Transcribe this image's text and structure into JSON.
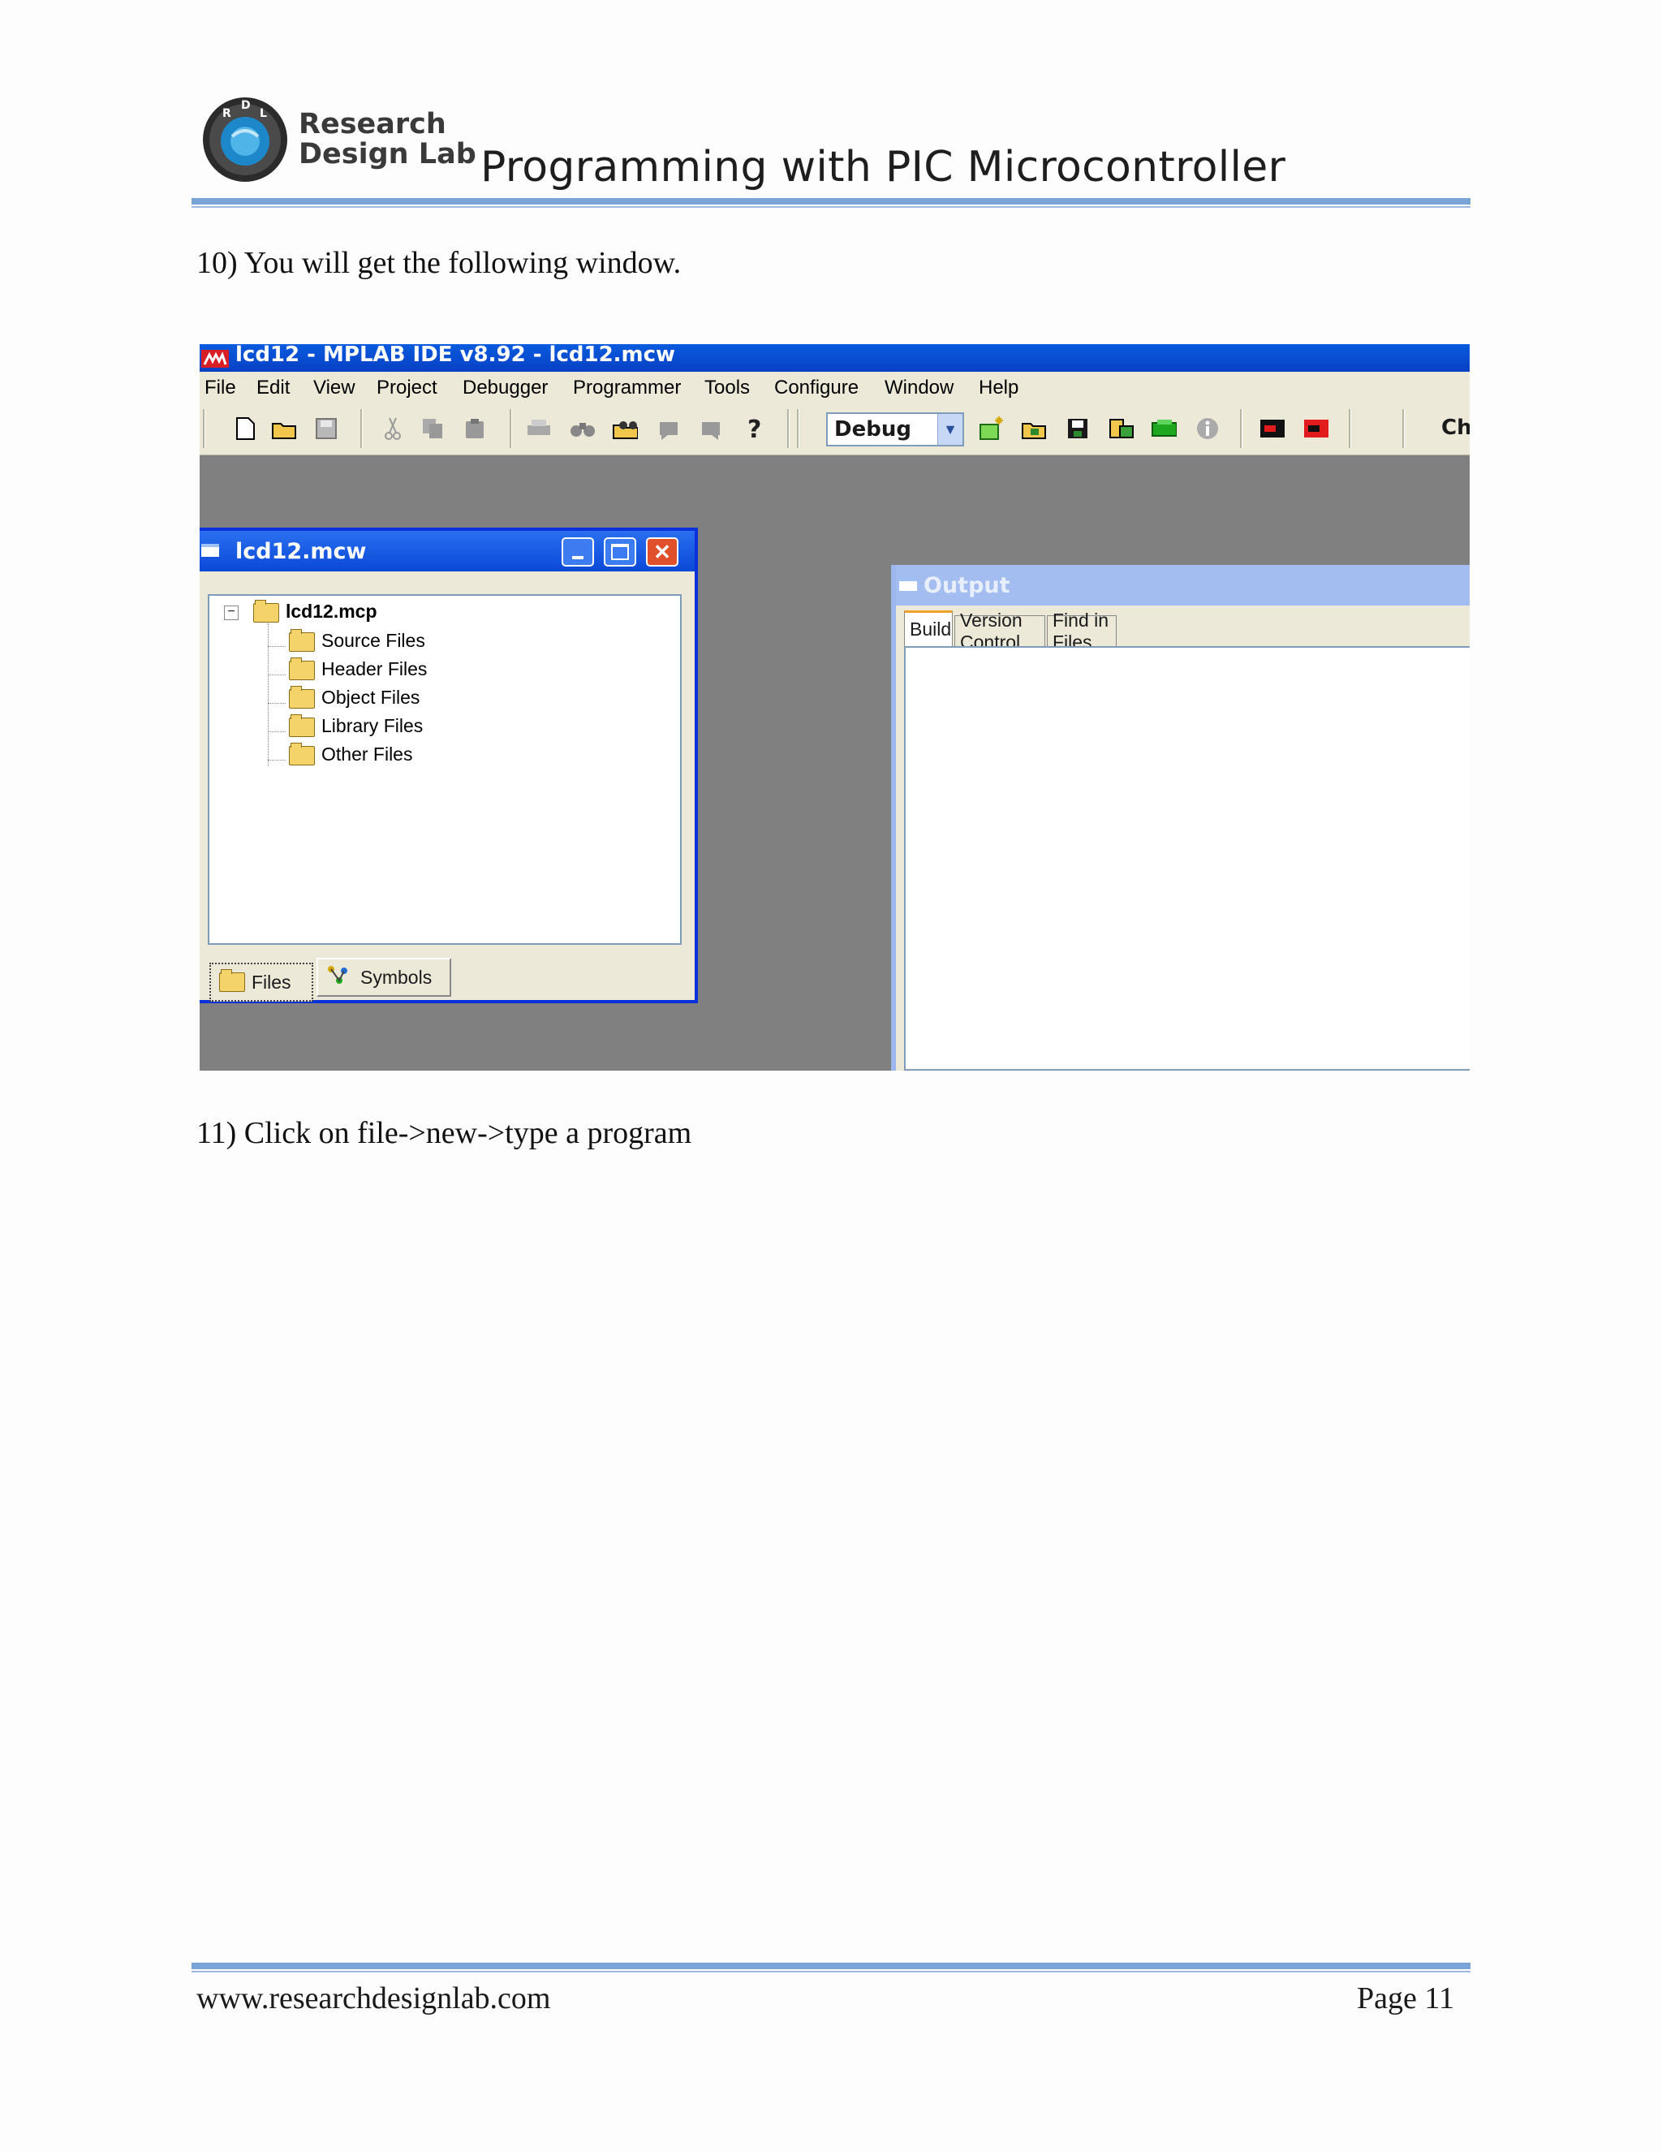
{
  "header": {
    "brand_line1": "Research",
    "brand_line2": "Design Lab",
    "logo_letters": "RDL",
    "title": "Programming with PIC Microcontroller",
    "rule_color": "#7aa3d8"
  },
  "body": {
    "step10": "10) You will get the following window.",
    "step11": "11) Click on file->new->type a program"
  },
  "screenshot": {
    "window_title": "lcd12 - MPLAB IDE v8.92 - lcd12.mcw",
    "menu": [
      "File",
      "Edit",
      "View",
      "Project",
      "Debugger",
      "Programmer",
      "Tools",
      "Configure",
      "Window",
      "Help"
    ],
    "toolbar": {
      "build_config": "Debug",
      "truncated_label": "Ch",
      "icons_left": [
        "new-file-icon",
        "open-folder-icon",
        "save-icon",
        "cut-icon",
        "copy-icon",
        "paste-icon",
        "print-icon",
        "find-icon",
        "find-in-files-icon",
        "back-icon",
        "forward-icon",
        "help-icon"
      ],
      "icons_right": [
        "new-project-icon",
        "open-project-icon",
        "save-project-icon",
        "project-wizard-icon",
        "build-icon",
        "info-icon",
        "device-red-icon",
        "device-red-2-icon"
      ]
    },
    "project_window": {
      "title": "lcd12.mcw",
      "project": "lcd12.mcp",
      "folders": [
        "Source Files",
        "Header Files",
        "Object Files",
        "Library Files",
        "Other Files"
      ],
      "tabs": [
        "Files",
        "Symbols"
      ]
    },
    "output_window": {
      "title": "Output",
      "tabs": [
        "Build",
        "Version Control",
        "Find in Files"
      ]
    },
    "colors": {
      "xp_blue": "#0a5bde",
      "workspace_gray": "#808080",
      "xp_face": "#ece9d8",
      "close_red": "#e0502b"
    }
  },
  "footer": {
    "url": "www.researchdesignlab.com",
    "page": "Page 11"
  }
}
